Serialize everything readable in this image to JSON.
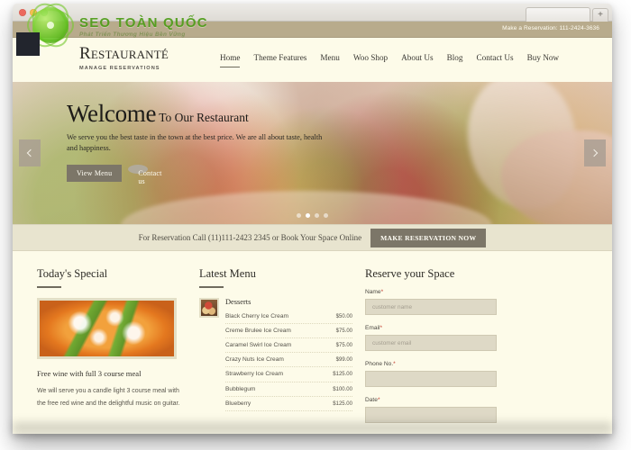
{
  "browser": {
    "traffic_lights": [
      "close",
      "minimize",
      "zoom"
    ],
    "new_tab_label": "+"
  },
  "topbar": {
    "reservation_text": "Make a Reservation: 111-2424-3636"
  },
  "header": {
    "brand_name": "Restauranté",
    "brand_tagline": "MANAGE RESERVATIONS",
    "nav": [
      {
        "label": "Home",
        "active": true
      },
      {
        "label": "Theme Features",
        "active": false
      },
      {
        "label": "Menu",
        "active": false
      },
      {
        "label": "Woo Shop",
        "active": false
      },
      {
        "label": "About Us",
        "active": false
      },
      {
        "label": "Blog",
        "active": false
      },
      {
        "label": "Contact Us",
        "active": false
      },
      {
        "label": "Buy Now",
        "active": false
      }
    ]
  },
  "hero": {
    "title_big": "Welcome",
    "title_small": "To Our Restaurant",
    "subtitle": "We serve you the best taste in the town at the best price. We are all about taste, health and happiness.",
    "buttons": [
      {
        "label": "View Menu",
        "style": "dark"
      },
      {
        "label": "Contact us",
        "style": "light"
      }
    ],
    "prev_arrow": "‹",
    "next_arrow": "›",
    "dots": 4,
    "active_dot": 1
  },
  "reservation_strip": {
    "text": "For Reservation Call (11)111-2423 2345 or Book Your Space Online",
    "button_label": "MAKE RESERVATION NOW"
  },
  "special": {
    "title": "Today's Special",
    "headline": "Free wine with full 3 course meal",
    "body": "We will serve you a candle light 3 course meal with the free red wine and the delightful music on guitar."
  },
  "latest_menu": {
    "title": "Latest Menu",
    "category": "Desserts",
    "items": [
      {
        "name": "Black Cherry Ice Cream",
        "price": "$50.00"
      },
      {
        "name": "Creme Brulee Ice Cream",
        "price": "$75.00"
      },
      {
        "name": "Caramel Swirl Ice Cream",
        "price": "$75.00"
      },
      {
        "name": "Crazy Nuts Ice Cream",
        "price": "$99.00"
      },
      {
        "name": "Strawberry Ice Cream",
        "price": "$125.00"
      },
      {
        "name": "Bubblegum",
        "price": "$100.00"
      },
      {
        "name": "Blueberry",
        "price": "$125.00"
      }
    ]
  },
  "reserve_form": {
    "title": "Reserve your Space",
    "fields": [
      {
        "label": "Name",
        "required": "*",
        "placeholder": "customer name",
        "value": ""
      },
      {
        "label": "Email",
        "required": "*",
        "placeholder": "customer email",
        "value": ""
      },
      {
        "label": "Phone No.",
        "required": "*",
        "placeholder": "",
        "value": ""
      },
      {
        "label": "Date",
        "required": "*",
        "placeholder": "",
        "value": ""
      }
    ]
  },
  "watermark": {
    "title": "SEO TOÀN QUỐC",
    "subtitle": "Phát Triển Thương Hiệu Bền Vững"
  },
  "colors": {
    "topbar": "#b8ab8c",
    "page_bg": "#fdfbe9",
    "accent_dark": "#7c7668",
    "strip_bg": "#e8e4cf",
    "required_red": "#c0392b",
    "watermark_green": "#4e9c18"
  }
}
